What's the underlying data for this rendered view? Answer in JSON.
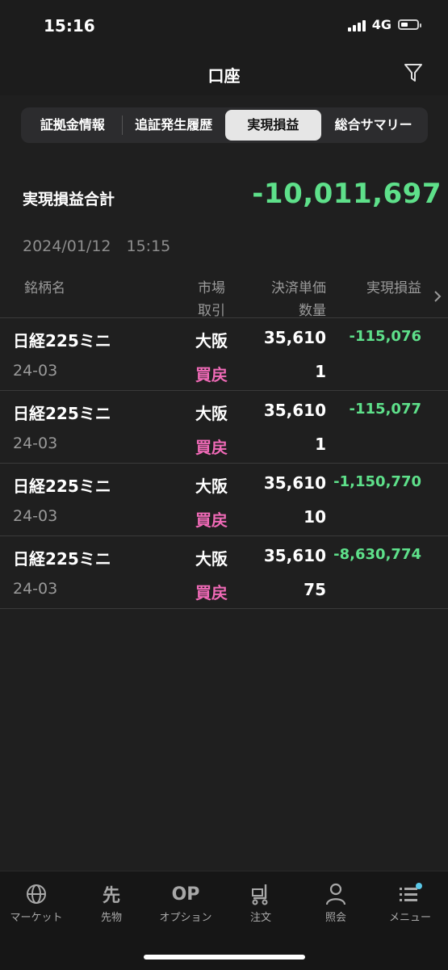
{
  "status": {
    "time": "15:16",
    "network": "4G"
  },
  "nav": {
    "title": "口座"
  },
  "tabs": [
    {
      "label": "証拠金情報"
    },
    {
      "label": "追証発生履歴"
    },
    {
      "label": "実現損益"
    },
    {
      "label": "総合サマリー"
    }
  ],
  "summary": {
    "label": "実現損益合計",
    "value": "-10,011,697",
    "datetime": "2024/01/12　15:15"
  },
  "table": {
    "headers": {
      "name": "銘柄名",
      "market": "市場",
      "trade": "取引",
      "price": "決済単価",
      "qty": "数量",
      "pnl": "実現損益"
    },
    "rows": [
      {
        "name": "日経225ミニ",
        "month": "24-03",
        "market": "大阪",
        "trade": "買戻",
        "price": "35,610",
        "qty": "1",
        "pnl": "-115,076"
      },
      {
        "name": "日経225ミニ",
        "month": "24-03",
        "market": "大阪",
        "trade": "買戻",
        "price": "35,610",
        "qty": "1",
        "pnl": "-115,077"
      },
      {
        "name": "日経225ミニ",
        "month": "24-03",
        "market": "大阪",
        "trade": "買戻",
        "price": "35,610",
        "qty": "10",
        "pnl": "-1,150,770"
      },
      {
        "name": "日経225ミニ",
        "month": "24-03",
        "market": "大阪",
        "trade": "買戻",
        "price": "35,610",
        "qty": "75",
        "pnl": "-8,630,774"
      }
    ]
  },
  "bottom_nav": [
    {
      "label": "マーケット",
      "icon": "globe-icon"
    },
    {
      "label": "先物",
      "glyph": "先",
      "icon": "futures-icon"
    },
    {
      "label": "オプション",
      "glyph": "OP",
      "icon": "options-icon"
    },
    {
      "label": "注文",
      "icon": "cart-icon"
    },
    {
      "label": "照会",
      "icon": "person-icon"
    },
    {
      "label": "メニュー",
      "icon": "menu-icon"
    }
  ],
  "colors": {
    "loss": "#5ee08a",
    "trade": "#f06ab7",
    "badge": "#5ac8e8"
  }
}
